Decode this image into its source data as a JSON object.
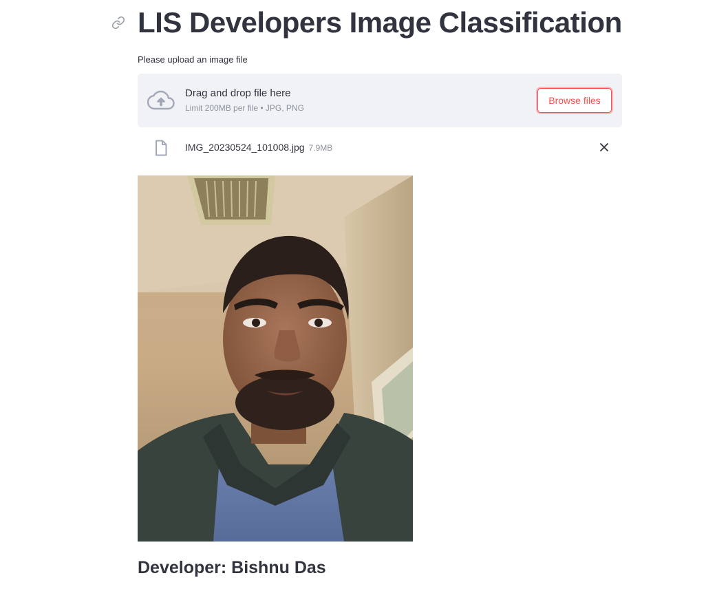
{
  "header": {
    "title": "LIS Developers Image Classification",
    "anchor_icon": "link-icon"
  },
  "uploader": {
    "label": "Please upload an image file",
    "dropzone_text": "Drag and drop file here",
    "limit_text": "Limit 200MB per file • JPG, PNG",
    "browse_label": "Browse files",
    "upload_icon": "cloud-upload-icon"
  },
  "uploaded_file": {
    "name": "IMG_20230524_101008.jpg",
    "size": "7.9MB",
    "file_icon": "file-icon",
    "remove_icon": "close-icon"
  },
  "image": {
    "subject": "portrait-photo"
  },
  "footer": {
    "developer_text": "Developer: Bishnu Das"
  },
  "colors": {
    "accent": "#ff4b4b",
    "text": "#31333f",
    "muted": "#8d929c",
    "dropzone_bg": "#f0f2f6"
  }
}
